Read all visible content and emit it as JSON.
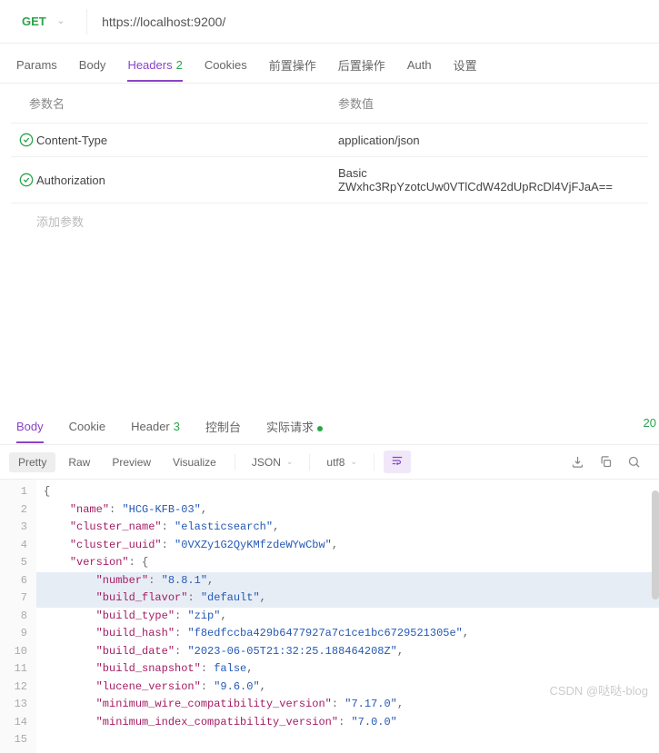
{
  "request": {
    "method": "GET",
    "url": "https://localhost:9200/"
  },
  "tabs": {
    "params": "Params",
    "body": "Body",
    "headers": "Headers",
    "headers_count": "2",
    "cookies": "Cookies",
    "pre": "前置操作",
    "post": "后置操作",
    "auth": "Auth",
    "settings": "设置"
  },
  "headers_table": {
    "col_name": "参数名",
    "col_value": "参数值",
    "rows": [
      {
        "name": "Content-Type",
        "value": "application/json"
      },
      {
        "name": "Authorization",
        "value": "Basic ZWxhc3RpYzotcUw0VTlCdW42dUpRcDl4VjFJaA=="
      }
    ],
    "add_placeholder": "添加参数"
  },
  "response_tabs": {
    "body": "Body",
    "cookie": "Cookie",
    "header": "Header",
    "header_count": "3",
    "console": "控制台",
    "actual": "实际请求"
  },
  "status_code": "20",
  "view_bar": {
    "pretty": "Pretty",
    "raw": "Raw",
    "preview": "Preview",
    "visualize": "Visualize",
    "format": "JSON",
    "encoding": "utf8"
  },
  "code": {
    "line_numbers": [
      "1",
      "2",
      "3",
      "4",
      "5",
      "6",
      "7",
      "8",
      "9",
      "10",
      "11",
      "12",
      "13",
      "14",
      "15"
    ],
    "l1": "{",
    "l2_k": "\"name\"",
    "l2_v": "\"HCG-KFB-03\"",
    "l3_k": "\"cluster_name\"",
    "l3_v": "\"elasticsearch\"",
    "l4_k": "\"cluster_uuid\"",
    "l4_v": "\"0VXZy1G2QyKMfzdeWYwCbw\"",
    "l5_k": "\"version\"",
    "l6_k": "\"number\"",
    "l6_v": "\"8.8.1\"",
    "l7_k": "\"build_flavor\"",
    "l7_v": "\"default\"",
    "l8_k": "\"build_type\"",
    "l8_v": "\"zip\"",
    "l9_k": "\"build_hash\"",
    "l9_v": "\"f8edfccba429b6477927a7c1ce1bc6729521305e\"",
    "l10_k": "\"build_date\"",
    "l10_v": "\"2023-06-05T21:32:25.188464208Z\"",
    "l11_k": "\"build_snapshot\"",
    "l11_v": "false",
    "l12_k": "\"lucene_version\"",
    "l12_v": "\"9.6.0\"",
    "l13_k": "\"minimum_wire_compatibility_version\"",
    "l13_v": "\"7.17.0\"",
    "l14_k": "\"minimum_index_compatibility_version\"",
    "l14_v": "\"7.0.0\""
  },
  "watermark": "CSDN @哒哒-blog"
}
